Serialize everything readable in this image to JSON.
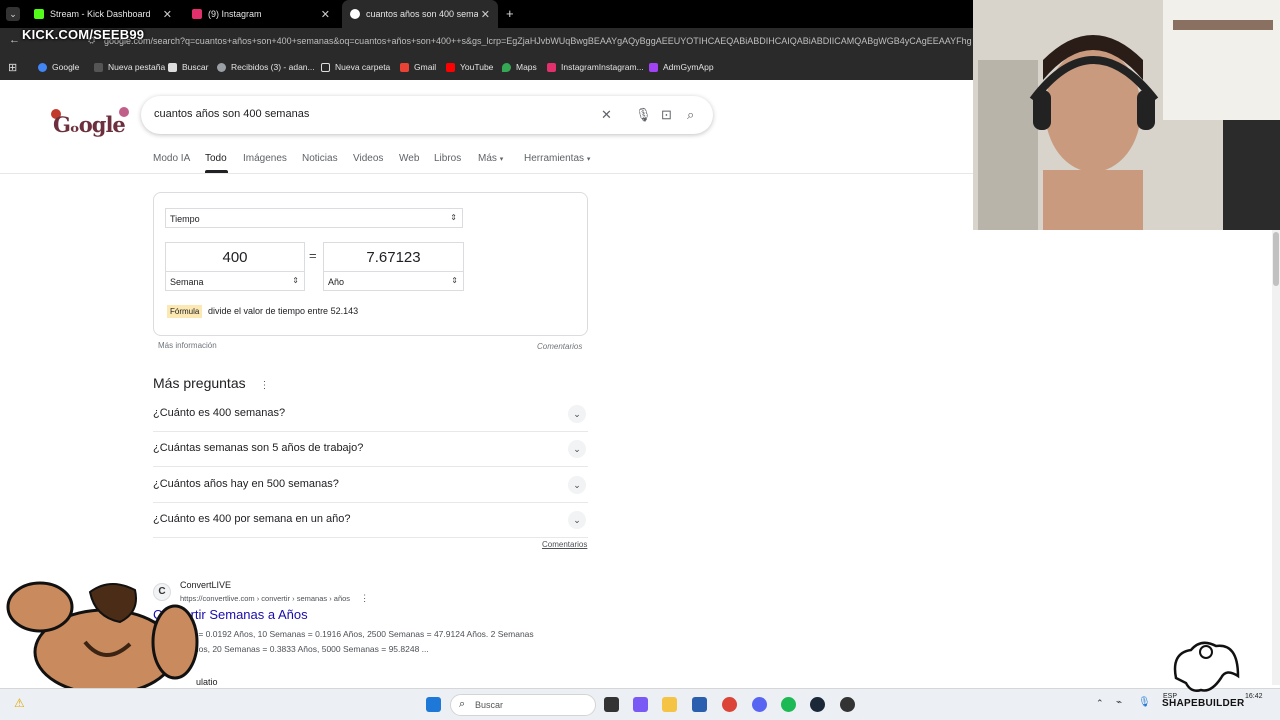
{
  "tabs": [
    {
      "label": "Stream - Kick Dashboard",
      "color": "#53fc18"
    },
    {
      "label": "(9) Instagram",
      "color": "#e1306c"
    },
    {
      "label": "cuantos años son 400 semanas",
      "color": "#4285f4"
    }
  ],
  "overlay": {
    "kick": "KICK.COM/SEEB99",
    "shapebuilder": "SHAPEBUILDER"
  },
  "address": {
    "url": "google.com/search?q=cuantos+años+son+400+semanas&oq=cuantos+años+son+400++s&gs_lcrp=EgZjaHJvbWUqBwgBEAAYgAQyBggAEEUYOTIHCAEQABiABDIHCAIQABiABDIICAMQABgWGB4yCAgEEAAYFhg"
  },
  "bookmarks": [
    {
      "label": "Google",
      "color": "#4285f4"
    },
    {
      "label": "Nueva pestaña",
      "color": "#888888"
    },
    {
      "label": "Buscar",
      "color": "#ffffff"
    },
    {
      "label": "Recibidos (3) - adan...",
      "color": "#9aa0a6"
    },
    {
      "label": "Nueva carpeta",
      "color": "#e8e8e8"
    },
    {
      "label": "Gmail",
      "color": "#ea4335"
    },
    {
      "label": "YouTube",
      "color": "#ff0000"
    },
    {
      "label": "Maps",
      "color": "#34a853"
    },
    {
      "label": "InstagramInstagram...",
      "color": "#e1306c"
    },
    {
      "label": "AdmGymApp",
      "color": "#a142f4"
    }
  ],
  "google": {
    "query": "cuantos años son 400 semanas",
    "tabs": [
      "Modo IA",
      "Todo",
      "Imágenes",
      "Noticias",
      "Videos",
      "Web",
      "Libros",
      "Más",
      "Herramientas"
    ]
  },
  "converter": {
    "category": "Tiempo",
    "from_value": "400",
    "to_value": "7.67123",
    "from_unit": "Semana",
    "to_unit": "Año",
    "equals": "=",
    "formula_tag": "Fórmula",
    "formula_text": "divide el valor de tiempo entre 52.143",
    "more_info": "Más información",
    "feedback": "Comentarios"
  },
  "paa": {
    "title": "Más preguntas",
    "questions": [
      "¿Cuánto es 400 semanas?",
      "¿Cuántas semanas son 5 años de trabajo?",
      "¿Cuántos años hay en 500 semanas?",
      "¿Cuánto es 400 por semana en un año?"
    ],
    "feedback": "Comentarios"
  },
  "result": {
    "site": "ConvertLIVE",
    "url": "https://convertlive.com › convertir › semanas › años",
    "title": "Convertir Semanas a Años",
    "snippet1": "1 Semanas = 0.0192 Años, 10 Semanas = 0.1916 Años, 2500 Semanas = 47.9124 Años. 2 Semanas",
    "snippet2": "= 0.0383 Años, 20 Semanas = 0.3833 Años, 5000 Semanas = 95.8248 ...",
    "next_partial": "ulatio"
  },
  "taskbar": {
    "search": "Buscar",
    "lang": "ESP",
    "time": "16:42"
  }
}
